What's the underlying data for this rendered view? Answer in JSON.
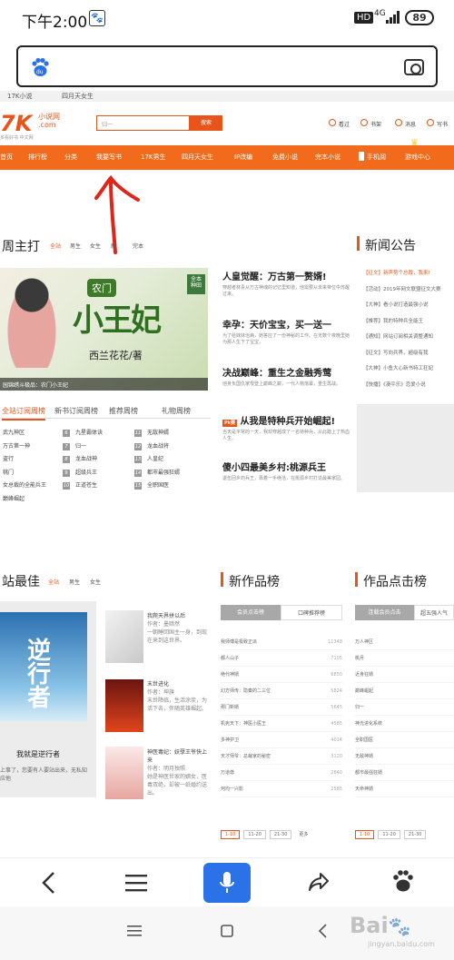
{
  "status": {
    "time": "下午2:00",
    "hd": "HD",
    "net": "4G",
    "battery": "89"
  },
  "browser": {
    "search_placeholder": ""
  },
  "page_tabs": [
    "17K小说",
    "四月天女生"
  ],
  "site": {
    "logo": "7K",
    "logo_sub": "小说网\n.com",
    "logo_tag": "多看好书 中文网",
    "search_placeholder": "归一",
    "search_button": "搜索",
    "header_links": [
      "看过",
      "书架",
      "消息",
      "写书"
    ]
  },
  "nav": [
    "首页",
    "排行榜",
    "分类",
    "我要写书",
    "17K男生",
    "四月天女生",
    "IP改编",
    "免费小说",
    "完本小说",
    "手机阅",
    "游戏中心"
  ],
  "section_main": {
    "title": "周主打",
    "filters": [
      "全站",
      "男生",
      "女生",
      "新",
      "完本"
    ]
  },
  "featured": {
    "tag": "农门",
    "big_title": "小王妃",
    "seal": "全本\n种田",
    "author": "西兰花花/著",
    "caption": "园锦绣斗极品：农门小王妃"
  },
  "news": [
    {
      "h": "人皇觉醒：万古第一赘婿!",
      "p": "穿越者林青从万古神魂的记忆里知道，他需要从未来帝位中苏醒过来。"
    },
    {
      "h": "幸孕：天价宝宝，买一送一",
      "p": "为了给妹妹治病，她答应了一份神秘的工作。在无数个夜晚里她为那人生下了宝宝。"
    },
    {
      "h": "决战巅峰：重生之金融秀莺",
      "p": "他身负国仇家恨登上巅峰之巅，一代人物落幕，重生再战。"
    },
    {
      "h": "从我是特种兵开始崛起!",
      "badge": "Pk赛",
      "p": "当天是平常的一天，我却穿越成了一名特种兵，从此踏上了热血人生。"
    },
    {
      "h": "傻小四最美乡村:桃源兵王",
      "p": "退伍回乡的兵王，靠着一手绝活，在桃源乡村打造最美家园。"
    }
  ],
  "rank_tabs": [
    "全站订阅周榜",
    "新书订阅周榜",
    "推荐周榜",
    "礼物周榜"
  ],
  "rank_left": [
    "武九神区",
    "万古第一神",
    "盗行",
    "桃门",
    "女总裁的全能兵王",
    "巅峰崛起"
  ],
  "rank_right_nums": [
    "6",
    "7",
    "8",
    "9",
    "10"
  ],
  "rank_right": [
    "九星霸体诀",
    "归一",
    "龙血战神",
    "超级兵王",
    "正道苍生"
  ],
  "rank_right2_nums": [
    "11",
    "12",
    "13",
    "14",
    "15"
  ],
  "rank_right2": [
    "无敌神婿",
    "龙血战将",
    "人皇纪",
    "都市最强狂婿",
    "全职国医"
  ],
  "notice_title": "新闻公告",
  "notices": [
    {
      "tag": "【征文】",
      "t": "新声势个总裁，我来!"
    },
    {
      "tag": "【活动】",
      "t": "2019年网文联盟征文大赛"
    },
    {
      "tag": "【大神】",
      "t": "看小说打造最强小说"
    },
    {
      "tag": "【推荐】",
      "t": "我的特种兵全能王"
    },
    {
      "tag": "【通知】",
      "t": "网站订阅相关调整通知"
    },
    {
      "tag": "【征文】",
      "t": "写向兵界，超级有我"
    },
    {
      "tag": "【大神】",
      "t": "小鱼大心新书特工狂妃"
    },
    {
      "tag": "【快播】",
      "t": "《凄平乐》恋爱小说"
    }
  ],
  "section_best": {
    "title": "站最佳",
    "filters": [
      "全站",
      "男生",
      "女生"
    ]
  },
  "best_book": {
    "cover_title": "逆行者",
    "title": "我就是逆行者",
    "desc": "上事了，您要有人要站出来，无私知应他"
  },
  "side_books": [
    {
      "title": "我爬天界拼以后",
      "author": "作者：墨暗然",
      "desc": "一朝睡回国主一身，到现在来到这世界。"
    },
    {
      "title": "末世进化",
      "author": "作者：坤旗",
      "desc": "末世降临，生活涂炭，为活下去，伴随英雄崛起。"
    },
    {
      "title": "神医毒妃：妖孽王爷快上来",
      "author": "作者：明月独照",
      "desc": "她是神医世家的嫡女，医毒双绝，却被一纸婚约送出。"
    }
  ],
  "new_rank": {
    "title": "新作品榜",
    "tabs": [
      "会员点击榜",
      "口碑推荐榜"
    ],
    "rows": [
      {
        "t": "我师傅是极致正派",
        "n": "11348"
      },
      {
        "t": "都人山子",
        "n": "7105"
      },
      {
        "t": "绝代神婿",
        "n": "6850"
      },
      {
        "t": "幻方师传：隐秦的二三位",
        "n": "5824"
      },
      {
        "t": "那门新婿",
        "n": "5645"
      },
      {
        "t": "机宪天下：神医小医王",
        "n": "4585"
      },
      {
        "t": "多神护卫",
        "n": "4014"
      },
      {
        "t": "天才师爷：总裁家的秘密",
        "n": "3120"
      },
      {
        "t": "万道尊",
        "n": "2840"
      },
      {
        "t": "何均一兴影",
        "n": "2585"
      }
    ],
    "pager": [
      "1-10",
      "11-20",
      "21-30",
      "更多"
    ]
  },
  "click_rank": {
    "title": "作品点击榜",
    "tabs": [
      "连载会员点击",
      "超五强人气"
    ],
    "rows": [
      "万人神区",
      "桃月",
      "近身狂婿",
      "巅峰崛起",
      "归一",
      "神光进化系统",
      "全职国医",
      "无敌神婿",
      "都市最强狂婿",
      "天命神婿"
    ],
    "pager": [
      "1-10",
      "11-20",
      "21-30"
    ]
  },
  "watermark": {
    "main": "Bai",
    "sub": "jingyan.baidu.com"
  }
}
